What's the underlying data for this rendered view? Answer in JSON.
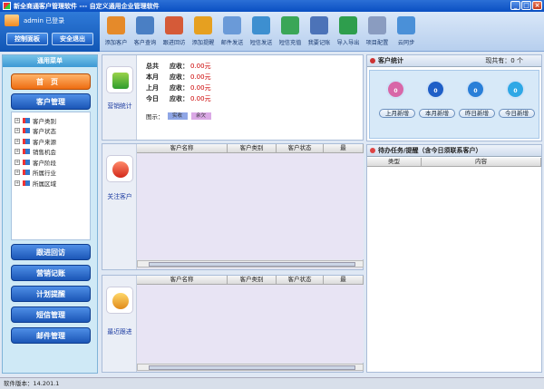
{
  "window": {
    "title": "新全商通客户管理软件 --- 自定义通用企业管理软件"
  },
  "user": {
    "name": "admin 已登录",
    "control_panel": "控制面板",
    "logout": "安全退出"
  },
  "toolbar": [
    {
      "label": "添加客户",
      "icon": "add-customer-icon",
      "color": "#e58a2a"
    },
    {
      "label": "客户查询",
      "icon": "customer-search-icon",
      "color": "#4a7fc4"
    },
    {
      "label": "跟进回访",
      "icon": "follow-up-icon",
      "color": "#d55a38"
    },
    {
      "label": "添加提醒",
      "icon": "alarm-clock-icon",
      "color": "#e6a020"
    },
    {
      "label": "邮件发送",
      "icon": "mail-icon",
      "color": "#6a9ad8"
    },
    {
      "label": "短信发送",
      "icon": "phone-icon",
      "color": "#3d8fd0"
    },
    {
      "label": "短信充值",
      "icon": "recharge-icon",
      "color": "#3aa657"
    },
    {
      "label": "我要记账",
      "icon": "ledger-icon",
      "color": "#4c73b8"
    },
    {
      "label": "导入导出",
      "icon": "import-export-icon",
      "color": "#2e9e4d"
    },
    {
      "label": "项目配置",
      "icon": "calendar-config-icon",
      "color": "#8a9cc0"
    },
    {
      "label": "云同步",
      "icon": "cloud-sync-icon",
      "color": "#4a90d8"
    }
  ],
  "sidebar": {
    "header": "通用菜单",
    "home": "首页",
    "customer_mgmt": "客户管理",
    "tree": [
      "客户类别",
      "客户状态",
      "客户来源",
      "销售机会",
      "客户阶段",
      "所属行业",
      "所属区域"
    ],
    "nav": [
      "跟进回访",
      "营销记账",
      "计划提醒",
      "短信管理",
      "邮件管理"
    ]
  },
  "sales": {
    "label": "营销统计",
    "rows": [
      {
        "period": "总共",
        "label": "应收：",
        "value": "0.00元"
      },
      {
        "period": "本月",
        "label": "应收：",
        "value": "0.00元"
      },
      {
        "period": "上月",
        "label": "应收：",
        "value": "0.00元"
      },
      {
        "period": "今日",
        "label": "应收：",
        "value": "0.00元"
      }
    ],
    "legend_label": "图示：",
    "legend": [
      {
        "name": "实收",
        "color": "#8fa6e6"
      },
      {
        "name": "余欠",
        "color": "#dba9e6"
      }
    ]
  },
  "attention": {
    "label": "关注客户",
    "columns": [
      "客户名称",
      "客户类别",
      "客户状态",
      "最"
    ]
  },
  "recent": {
    "label": "最近跟进",
    "columns": [
      "客户名称",
      "客户类别",
      "客户状态",
      "最"
    ]
  },
  "customer_stats": {
    "title": "客户统计",
    "total": "现共有：0 个",
    "items": [
      {
        "label": "上月新增",
        "value": "0",
        "color": "#d867a8"
      },
      {
        "label": "本月新增",
        "value": "0",
        "color": "#1f5fc7"
      },
      {
        "label": "昨日新增",
        "value": "0",
        "color": "#2a7fd8"
      },
      {
        "label": "今日新增",
        "value": "0",
        "color": "#2fa8e6"
      }
    ]
  },
  "tasks": {
    "title": "待办任务/提醒（含今日须联系客户）",
    "columns": [
      "类型",
      "内容"
    ]
  },
  "status": {
    "version": "软件版本：14.201.1"
  }
}
